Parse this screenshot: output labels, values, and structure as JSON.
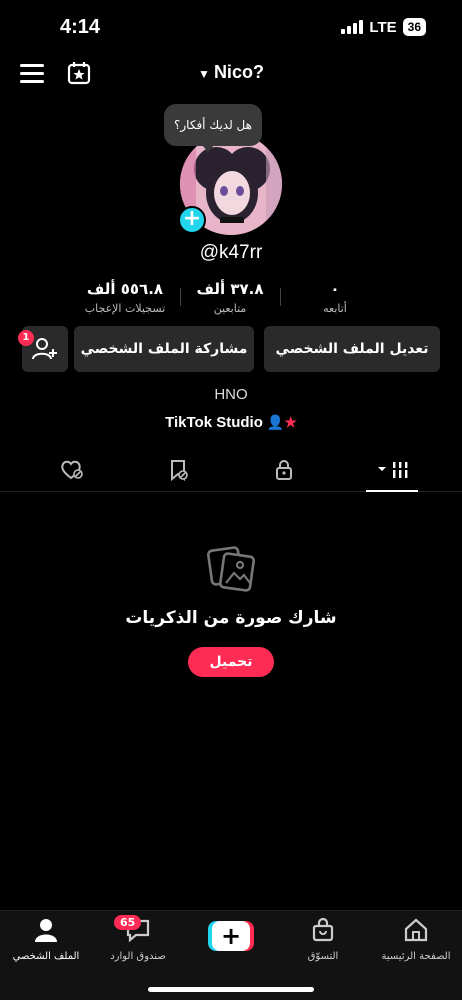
{
  "status": {
    "time": "4:14",
    "network": "LTE",
    "battery": "36"
  },
  "header": {
    "username": "Nico?"
  },
  "profile": {
    "thought_bubble": "هل لديك أفكار؟",
    "handle": "@k47rr",
    "bio": "HNO",
    "link": "TikTok Studio"
  },
  "stats": {
    "following": {
      "value": "٠",
      "label": "أتابعه"
    },
    "followers": {
      "value": "٣٧.٨ ألف",
      "label": "متابعين"
    },
    "likes": {
      "value": "٥٥٦.٨ ألف",
      "label": "تسجيلات الإعجاب"
    }
  },
  "actions": {
    "edit": "تعديل الملف الشخصي",
    "share": "مشاركة الملف الشخصي",
    "friends_badge": "1"
  },
  "empty_state": {
    "title": "شارك صورة من الذكريات",
    "button": "تحميل"
  },
  "bottom_nav": {
    "home": "الصفحة الرئيسية",
    "shop": "التسوّق",
    "inbox": "صندوق الوارد",
    "inbox_badge": "65",
    "profile": "الملف الشخصي"
  },
  "colors": {
    "accent": "#fe2c55",
    "cyan": "#20d5ec",
    "button_bg": "#2a2a2a"
  }
}
